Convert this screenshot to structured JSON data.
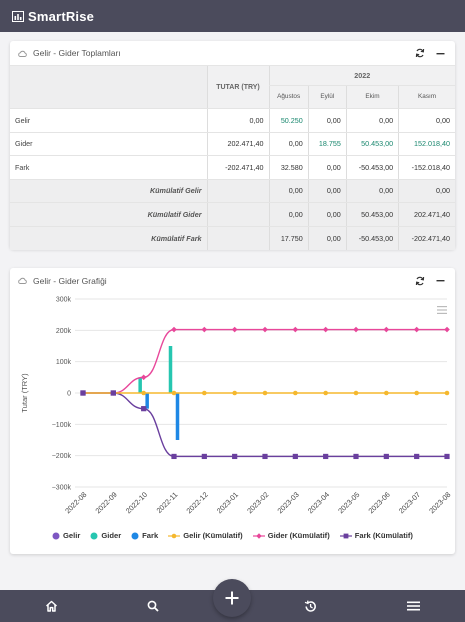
{
  "app": {
    "title": "SmartRise"
  },
  "table_card": {
    "title": "Gelir - Gider Toplamları",
    "total_header": "TUTAR (TRY)",
    "year": "2022",
    "months": [
      "Ağustos",
      "Eylül",
      "Ekim",
      "Kasım"
    ],
    "rows": [
      {
        "label": "Gelir",
        "total": "0,00",
        "values": [
          "50.250",
          "0,00",
          "0,00",
          "0,00"
        ],
        "kind": "plain"
      },
      {
        "label": "Gider",
        "total": "202.471,40",
        "values": [
          "0,00",
          "18.755",
          "50.453,00",
          "152.018,40"
        ],
        "kind": "plain"
      },
      {
        "label": "Fark",
        "total": "-202.471,40",
        "values": [
          "32.580",
          "0,00",
          "-50.453,00",
          "-152.018,40"
        ],
        "kind": "plain"
      },
      {
        "label": "Kümülatif Gelir",
        "total": "",
        "values": [
          "0,00",
          "0,00",
          "0,00",
          "0,00"
        ],
        "kind": "kum"
      },
      {
        "label": "Kümülatif Gider",
        "total": "",
        "values": [
          "0,00",
          "0,00",
          "50.453,00",
          "202.471,40"
        ],
        "kind": "kum"
      },
      {
        "label": "Kümülatif Fark",
        "total": "",
        "values": [
          "17.750",
          "0,00",
          "-50.453,00",
          "-202.471,40"
        ],
        "kind": "kum"
      }
    ],
    "colors": {
      "green": "#19876e"
    }
  },
  "chart_card": {
    "title": "Gelir - Gider Grafiği"
  },
  "chart_data": {
    "type": "line",
    "ylabel": "Tutar (TRY)",
    "ylim": [
      -300000,
      300000
    ],
    "yticks": [
      "300k",
      "200k",
      "100k",
      "0",
      "−100k",
      "−200k",
      "−300k"
    ],
    "x": [
      "2022-08",
      "2022-09",
      "2022-10",
      "2022-11",
      "2022-12",
      "2023-01",
      "2023-02",
      "2023-03",
      "2023-04",
      "2023-05",
      "2023-06",
      "2023-07",
      "2023-08"
    ],
    "bars": [
      {
        "name": "Gelir",
        "color": "#7e57c2",
        "values": [
          0,
          0,
          0,
          0,
          0,
          0,
          0,
          0,
          0,
          0,
          0,
          0,
          0
        ]
      },
      {
        "name": "Gider",
        "color": "#26c6b0",
        "values": [
          0,
          0,
          50000,
          150000,
          0,
          0,
          0,
          0,
          0,
          0,
          0,
          0,
          0
        ]
      },
      {
        "name": "Fark",
        "color": "#1e88e5",
        "values": [
          0,
          0,
          -50000,
          -150000,
          0,
          0,
          0,
          0,
          0,
          0,
          0,
          0,
          0
        ]
      }
    ],
    "series": [
      {
        "name": "Gelir (Kümülatif)",
        "color": "#f5b82e",
        "values": [
          0,
          0,
          0,
          0,
          0,
          0,
          0,
          0,
          0,
          0,
          0,
          0,
          0
        ]
      },
      {
        "name": "Gider (Kümülatif)",
        "color": "#e8479a",
        "values": [
          0,
          0,
          50000,
          202471,
          202471,
          202471,
          202471,
          202471,
          202471,
          202471,
          202471,
          202471,
          202471
        ]
      },
      {
        "name": "Fark (Kümülatif)",
        "color": "#6a3f9e",
        "values": [
          0,
          0,
          -50000,
          -202471,
          -202471,
          -202471,
          -202471,
          -202471,
          -202471,
          -202471,
          -202471,
          -202471,
          -202471
        ]
      }
    ],
    "grid": true,
    "legend": "bottom"
  },
  "nav": {
    "items": [
      "home-icon",
      "search-icon",
      "add-icon",
      "history-icon",
      "menu-icon"
    ]
  }
}
